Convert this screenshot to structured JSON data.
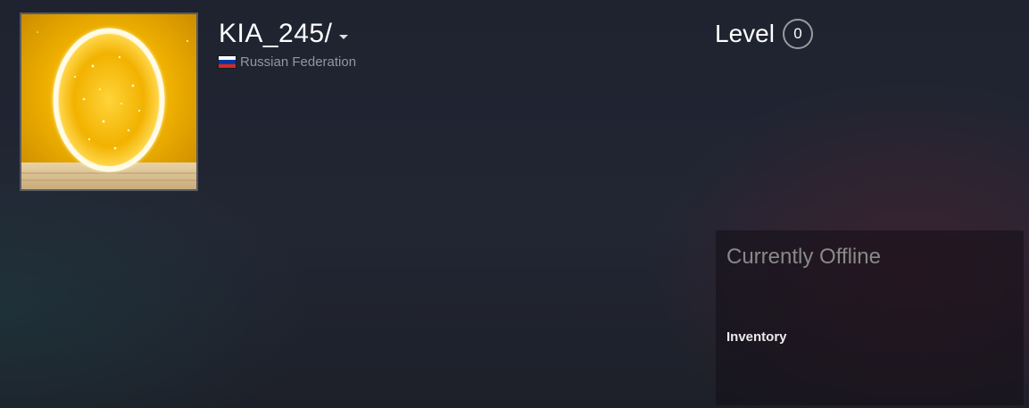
{
  "profile": {
    "persona_name": "KIA_245/",
    "location": "Russian Federation",
    "flag_icon": "flag-russia-icon",
    "flag_colors": [
      "#ffffff",
      "#0039a6",
      "#d52b1e"
    ],
    "avatar_icon": "glowing-portal-avatar"
  },
  "level": {
    "label": "Level",
    "value": "0"
  },
  "status_panel": {
    "status": "Currently Offline",
    "inventory_label": "Inventory"
  }
}
